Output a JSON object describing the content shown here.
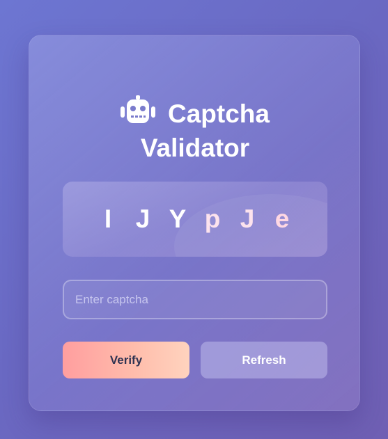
{
  "title": {
    "icon": "robot-icon",
    "line1": "Captcha",
    "line2": "Validator"
  },
  "captcha": {
    "chars": [
      {
        "char": "I",
        "color": "#ffffff"
      },
      {
        "char": "J",
        "color": "#ffffff"
      },
      {
        "char": "Y",
        "color": "#ffffff"
      },
      {
        "char": "p",
        "color": "#fde2ec"
      },
      {
        "char": "J",
        "color": "#fde2ec"
      },
      {
        "char": "e",
        "color": "#ffd6e2"
      }
    ]
  },
  "input": {
    "value": "",
    "placeholder": "Enter captcha"
  },
  "buttons": {
    "verify_label": "Verify",
    "refresh_label": "Refresh"
  },
  "colors": {
    "verify_gradient_start": "#ff9e9f",
    "verify_gradient_end": "#ffd3be",
    "background": "#6a69c3"
  }
}
